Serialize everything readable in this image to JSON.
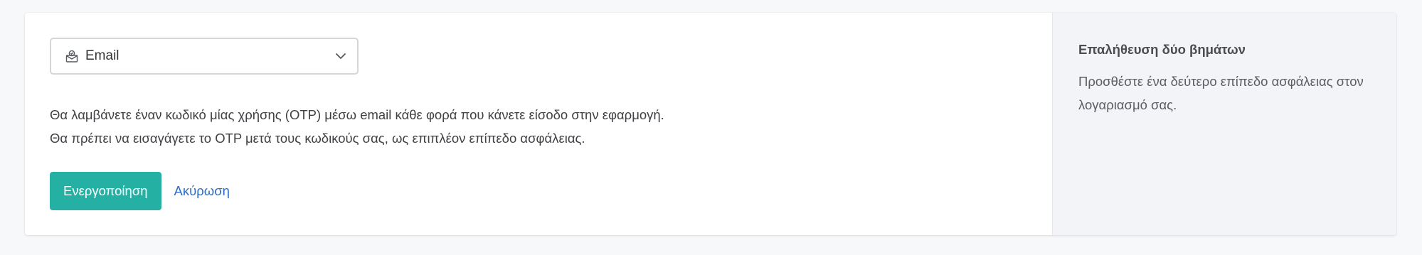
{
  "two_factor": {
    "method_select": {
      "selected_value": "Email",
      "icon": "envelope-badge-icon"
    },
    "description": {
      "line1": "Θα λαμβάνετε έναν κωδικό μίας χρήσης (OTP) μέσω email κάθε φορά που κάνετε είσοδο στην εφαρμογή.",
      "line2": "Θα πρέπει να εισαγάγετε το OTP μετά τους κωδικούς σας, ως επιπλέον επίπεδο ασφάλειας."
    },
    "actions": {
      "activate_label": "Ενεργοποίηση",
      "cancel_label": "Ακύρωση"
    }
  },
  "sidebar": {
    "title": "Επαλήθευση δύο βημάτων",
    "description": "Προσθέστε ένα δεύτερο επίπεδο ασφάλειας στον λογαριασμό σας."
  },
  "colors": {
    "primary": "#25b0a4",
    "link": "#2d6cc0",
    "side_background": "#f3f4f7",
    "page_background": "#f7f8fa"
  }
}
